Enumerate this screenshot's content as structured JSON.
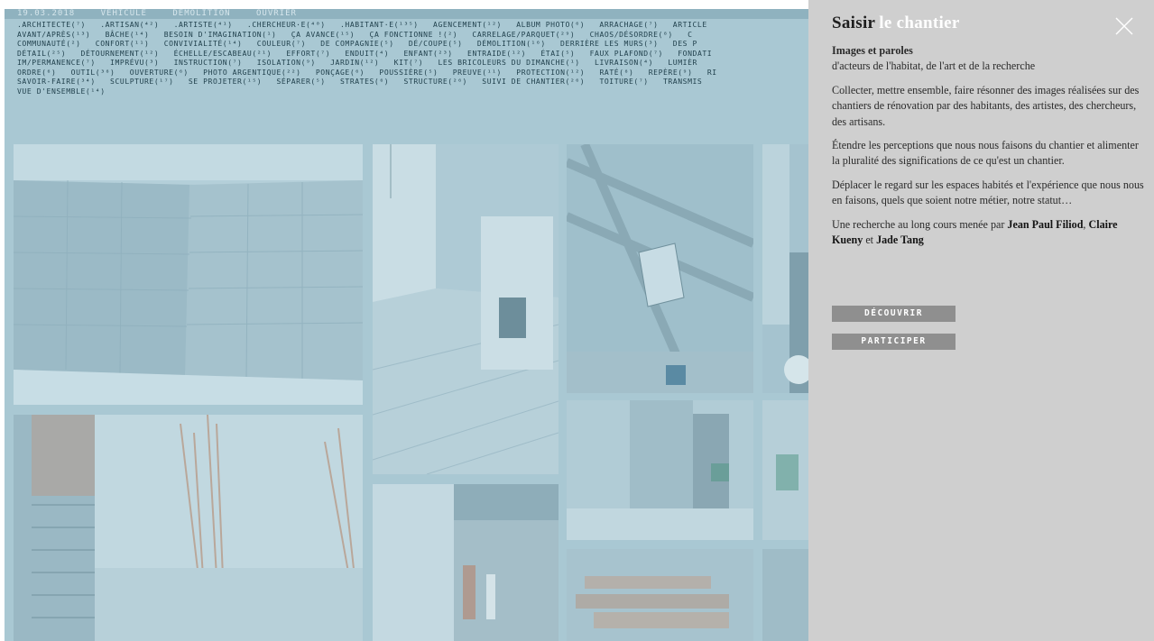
{
  "topbar": [
    "19.03.2018",
    "VÉHICULE",
    "DÉMOLITION",
    "OUVRIER"
  ],
  "tags": [
    [
      ".ARCHITECTE(⁷)",
      ".ARTISAN(⁴²)",
      ".ARTISTE(⁴¹)",
      ".CHERCHEUR·E(⁴⁰)",
      ".HABITANT·E(¹³⁵)",
      "AGENCEMENT(¹²)",
      "ALBUM PHOTO(⁶)",
      "ARRACHAGE(⁷)",
      "ARTICLE"
    ],
    [
      "AVANT/APRÈS(¹³)",
      "BÂCHE(¹⁴)",
      "BESOIN D'IMAGINATION(¹)",
      "ÇA AVANCE(¹⁵)",
      "ÇA FONCTIONNE !(²)",
      "CARRELAGE/PARQUET(²⁹)",
      "CHAOS/DÉSORDRE(⁸)",
      "C"
    ],
    [
      "COMMUNAUTÉ(²)",
      "CONFORT(¹¹)",
      "CONVIVIALITÉ(¹⁴)",
      "COULEUR(⁷)",
      "DE COMPAGNIE(⁵)",
      "DÉ/COUPE(⁵)",
      "DÉMOLITION(¹⁶)",
      "DERRIÈRE LES MURS(³)",
      "DES P"
    ],
    [
      "DÉTAIL(²⁵)",
      "DÉTOURNEMENT(¹²)",
      "ÉCHELLE/ESCABEAU(²¹)",
      "EFFORT(⁷)",
      "ENDUIT(⁴)",
      "ENFANT(²³)",
      "ENTRAIDE(¹²)",
      "ÉTAI(⁵)",
      "FAUX PLAFOND(⁷)",
      "FONDATI"
    ],
    [
      "IM/PERMANENCE(⁷)",
      "IMPRÉVU(³)",
      "INSTRUCTION(⁷)",
      "ISOLATION(⁹)",
      "JARDIN(¹²)",
      "KIT(⁷)",
      "LES BRICOLEURS DU DIMANCHE(¹)",
      "LIVRAISON(⁴)",
      "LUMIÈR"
    ],
    [
      "ORDRE(⁶)",
      "OUTIL(³⁸)",
      "OUVERTURE(⁶)",
      "PHOTO ARGENTIQUE(²²)",
      "PONÇAGE(⁶)",
      "POUSSIÈRE(⁵)",
      "PREUVE(¹¹)",
      "PROTECTION(¹²)",
      "RATÉ(⁸)",
      "REPÈRE(⁹)",
      "RI"
    ],
    [
      "SAVOIR-FAIRE(³⁴)",
      "SCULPTURE(¹⁷)",
      "SE PROJETER(¹⁵)",
      "SÉPARER(⁵)",
      "STRATES(⁶)",
      "STRUCTURE(²⁶)",
      "SUIVI DE CHANTIER(²⁶)",
      "TOITURE(⁷)",
      "TRANSMIS"
    ],
    [
      "VUE D'ENSEMBLE(¹⁴)"
    ]
  ],
  "panel": {
    "title": "Saisir",
    "title_highlight": "le chantier",
    "subtitle": "Images et paroles",
    "subtitle_line": "d'acteurs de l'habitat, de l'art et de la recherche",
    "p1": "Collecter, mettre ensemble, faire résonner des images réalisées sur des chantiers de rénovation par des habitants, des artistes, des chercheurs, des artisans.",
    "p2": "Étendre les perceptions que nous nous faisons du chantier et alimenter la pluralité des significations de ce qu'est un chantier.",
    "p3": "Déplacer le regard sur les espaces habités et l'expérience que nous nous en faisons, quels que soient notre métier, notre statut…",
    "p4_prefix": "Une recherche au long cours menée par",
    "author1": "Jean Paul Filiod",
    "author2": "Claire Kueny",
    "p4_and": "et",
    "author3": "Jade Tang",
    "btn_discover": "DÉCOUVRIR",
    "btn_participate": "PARTICIPER",
    "close_icon": "close-icon"
  },
  "colors": {
    "overlay": "#a9c8d3",
    "panel": "#cfcfcf",
    "button": "#8f8f8f",
    "tag_text": "#1f3f4b"
  }
}
